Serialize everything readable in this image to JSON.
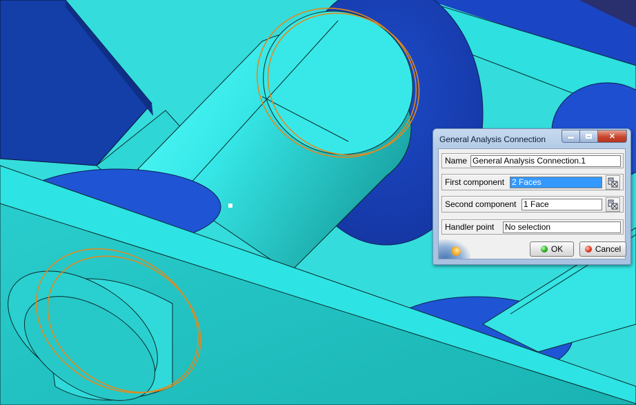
{
  "dialog": {
    "title": "General Analysis Connection",
    "window_buttons": {
      "minimize": "minimize",
      "maximize": "maximize",
      "close": "✕"
    },
    "name_label": "Name",
    "name_value": "General Analysis Connection.1",
    "first_component_label": "First component",
    "first_component_value": "2 Faces",
    "second_component_label": "Second component",
    "second_component_value": "1 Face",
    "handler_point_label": "Handler point",
    "handler_point_value": "No selection",
    "ok_label": "OK",
    "cancel_label": "Cancel"
  },
  "icons": {
    "pick": "edit-list-icon",
    "ok": "green-ball-icon",
    "cancel": "red-ball-icon",
    "logo": "catia-logo-icon"
  },
  "colors": {
    "highlight": "#3399ff",
    "selection_outline": "#e08a1e",
    "part_cyan": "#39e0e0",
    "part_blue": "#1a3fb0"
  }
}
